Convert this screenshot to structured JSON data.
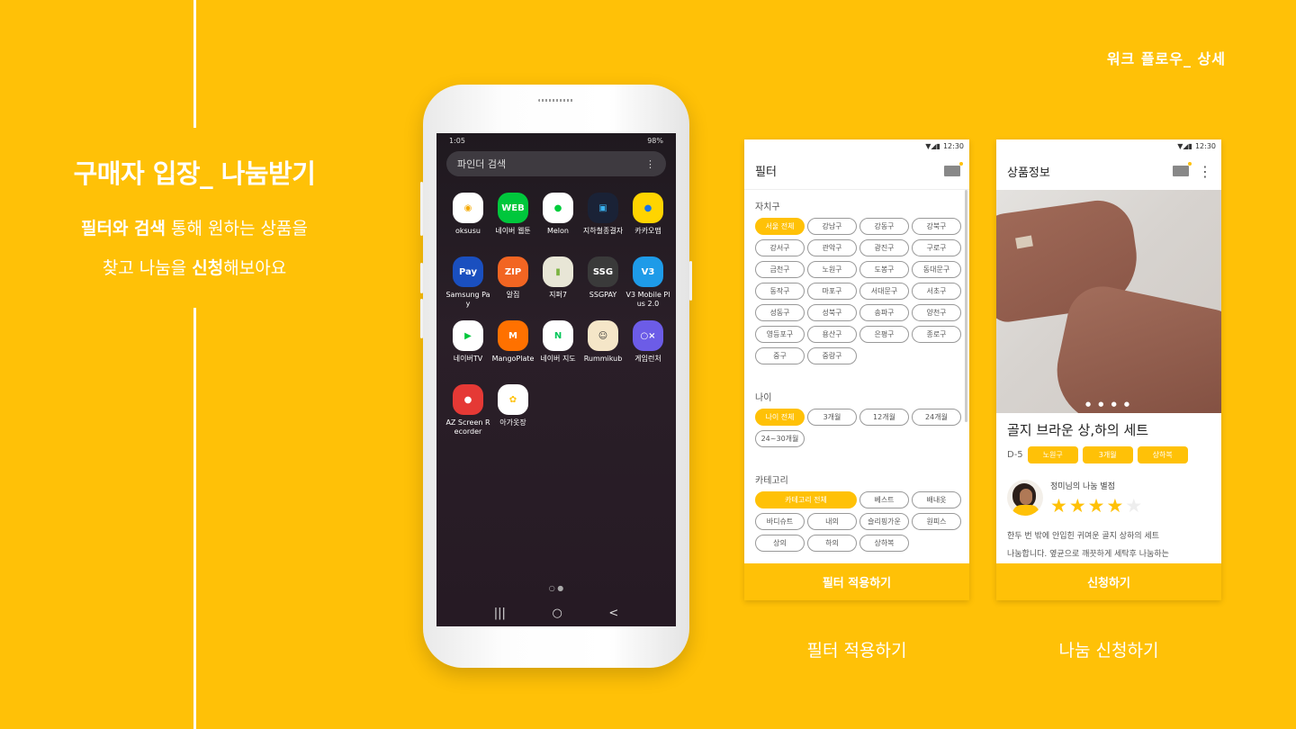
{
  "header": {
    "top_right": "워크 플로우_ 상세"
  },
  "left": {
    "title": "구매자 입장_ 나눔받기",
    "desc_line1_bold": "필터와 검색",
    "desc_line1_rest": " 통해 원하는 상품을",
    "desc_line2_pre": "찾고 나눔을 ",
    "desc_line2_bold": "신청",
    "desc_line2_post": "해보아요"
  },
  "phone": {
    "status_time": "1:05",
    "status_battery": "98%",
    "search_placeholder": "파인더 검색",
    "search_menu": "⋮",
    "apps": [
      {
        "label": "oksusu",
        "icon": "oksusu-icon",
        "glyph": "◉",
        "bg": "#ffffff",
        "fg": "#f5a900"
      },
      {
        "label": "네이버 웹툰",
        "icon": "webtoon-icon",
        "glyph": "WEB",
        "bg": "#00c73c",
        "fg": "#ffffff"
      },
      {
        "label": "Melon",
        "icon": "melon-icon",
        "glyph": "●",
        "bg": "#ffffff",
        "fg": "#00cd3c"
      },
      {
        "label": "지하철종결자",
        "icon": "subway-icon",
        "glyph": "▣",
        "bg": "#1a2236",
        "fg": "#3ab4f2"
      },
      {
        "label": "카카오맵",
        "icon": "kakaomap-icon",
        "glyph": "●",
        "bg": "#ffd400",
        "fg": "#1a73e8"
      },
      {
        "label": "Samsung Pay",
        "icon": "samsung-pay-icon",
        "glyph": "Pay",
        "bg": "#1a4fbf",
        "fg": "#ffffff"
      },
      {
        "label": "알집",
        "icon": "alzip-icon",
        "glyph": "ZIP",
        "bg": "#f26522",
        "fg": "#ffffff"
      },
      {
        "label": "지퍼7",
        "icon": "zipper-icon",
        "glyph": "▮",
        "bg": "#e8e6d6",
        "fg": "#7cb342"
      },
      {
        "label": "SSGPAY",
        "icon": "ssgpay-icon",
        "glyph": "SSG",
        "bg": "#3a3a3a",
        "fg": "#ffffff"
      },
      {
        "label": "V3 Mobile Plus 2.0",
        "icon": "v3-icon",
        "glyph": "V3",
        "bg": "#1e9be8",
        "fg": "#ffffff"
      },
      {
        "label": "네이버TV",
        "icon": "navertv-icon",
        "glyph": "▶",
        "bg": "#ffffff",
        "fg": "#00c73c"
      },
      {
        "label": "MangoPlate",
        "icon": "mangoplate-icon",
        "glyph": "M",
        "bg": "#ff7100",
        "fg": "#ffffff"
      },
      {
        "label": "네이버 지도",
        "icon": "navermap-icon",
        "glyph": "N",
        "bg": "#ffffff",
        "fg": "#03c75a"
      },
      {
        "label": "Rummikub",
        "icon": "rummikub-icon",
        "glyph": "☺",
        "bg": "#f5e6c8",
        "fg": "#333333"
      },
      {
        "label": "게임런처",
        "icon": "game-launcher-icon",
        "glyph": "○×",
        "bg": "#6c5ce7",
        "fg": "#ffffff"
      },
      {
        "label": "AZ Screen Recorder",
        "icon": "az-recorder-icon",
        "glyph": "●",
        "bg": "#e53935",
        "fg": "#ffffff"
      },
      {
        "label": "아가옷장",
        "icon": "agaotjang-icon",
        "glyph": "✿",
        "bg": "#ffffff",
        "fg": "#ffc107"
      }
    ],
    "pager": "○ ●",
    "nav": {
      "recent": "|||",
      "home": "○",
      "back": "<"
    }
  },
  "filter_screen": {
    "status_time": "12:30",
    "title": "필터",
    "section_region": "자치구",
    "regions": [
      "서울 전체",
      "강남구",
      "강동구",
      "강북구",
      "강서구",
      "관악구",
      "광진구",
      "구로구",
      "금천구",
      "노원구",
      "도봉구",
      "동대문구",
      "동작구",
      "마포구",
      "서대문구",
      "서초구",
      "성동구",
      "성북구",
      "송파구",
      "양천구",
      "영등포구",
      "용산구",
      "은평구",
      "종로구",
      "중구",
      "중랑구"
    ],
    "section_age": "나이",
    "ages": [
      "나이 전체",
      "3개월",
      "12개월",
      "24개월",
      "24~30개월"
    ],
    "section_category": "카테고리",
    "categories": [
      "카테고리 전체",
      "베스트",
      "배내옷",
      "바디슈트",
      "내의",
      "슬리핑가운",
      "원피스",
      "상의",
      "하의",
      "상하복"
    ],
    "apply_button": "필터 적용하기",
    "caption": "필터 적용하기"
  },
  "product_screen": {
    "status_time": "12:30",
    "title": "상품정보",
    "menu": "⋮",
    "photo_dots": "● ● ● ●",
    "product_title": "골지 브라운 상,하의 세트",
    "dday": "D-5",
    "tags": [
      "노원구",
      "3개월",
      "상하복"
    ],
    "review_title": "정미님의 나눔 별점",
    "rating": 4,
    "rating_max": 5,
    "desc_line1": "한두 번 밖에 안입힌 귀여운 골지 상하의 세트",
    "desc_line2": "나눔합니다. 옆균으로 깨끗하게 세탁후 나눔하는",
    "apply_button": "신청하기",
    "caption": "나눔 신청하기"
  }
}
